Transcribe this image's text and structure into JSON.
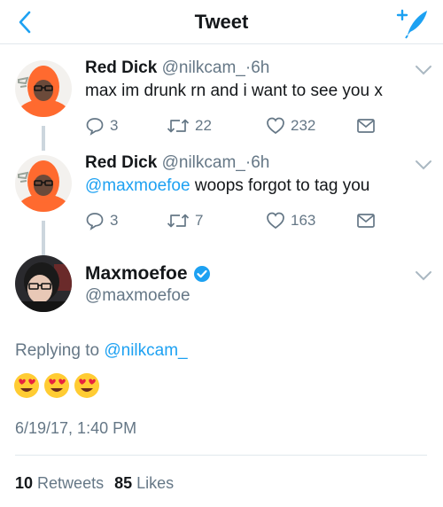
{
  "header": {
    "title": "Tweet",
    "back_icon": "chevron-left-icon",
    "compose_icon": "compose-tweet-icon"
  },
  "colors": {
    "accent": "#1da1f2",
    "text": "#14171a",
    "muted": "#657786",
    "divider": "#e1e8ed"
  },
  "thread": [
    {
      "name": "Red Dick",
      "handle": "@nilkcam_",
      "separator": "·",
      "time": "6h",
      "text_mention": "",
      "text": "max im drunk rn and i want to see you x",
      "replies": "3",
      "retweets": "22",
      "likes": "232"
    },
    {
      "name": "Red Dick",
      "handle": "@nilkcam_",
      "separator": "·",
      "time": "6h",
      "text_mention": "@maxmoefoe",
      "text": " woops forgot to tag you",
      "replies": "3",
      "retweets": "7",
      "likes": "163"
    }
  ],
  "main_tweet": {
    "name": "Maxmoefoe",
    "handle": "@maxmoefoe",
    "replying_prefix": "Replying to ",
    "replying_to": "@nilkcam_",
    "emojis": [
      "heart-eyes-emoji",
      "heart-eyes-emoji",
      "heart-eyes-emoji"
    ],
    "date": "6/19/17, 1:40 PM",
    "retweet_count": "10",
    "retweet_label": "Retweets",
    "like_count": "85",
    "like_label": "Likes"
  }
}
